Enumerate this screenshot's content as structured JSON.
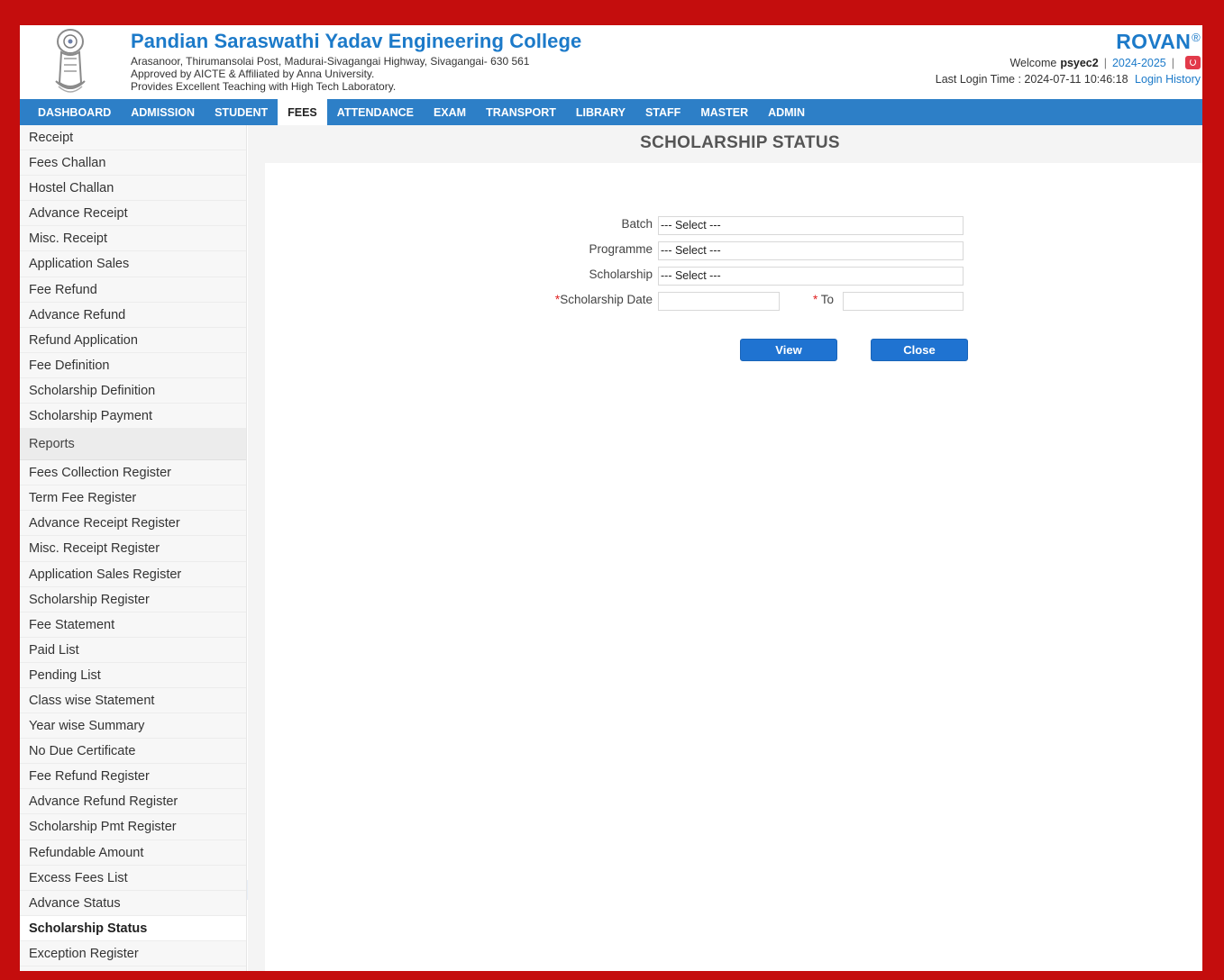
{
  "header": {
    "college_name": "Pandian Saraswathi Yadav Engineering College",
    "address_line1": "Arasanoor, Thirumansolai Post, Madurai-Sivagangai Highway, Sivagangai- 630 561",
    "address_line2": "Approved by AICTE & Affiliated by Anna University.",
    "address_line3": "Provides Excellent Teaching with High Tech Laboratory.",
    "brand": "ROVAN",
    "brand_mark": "®",
    "welcome_label": "Welcome",
    "username": "psyec2",
    "academic_year": "2024-2025",
    "separator": "|",
    "last_login_label": "Last Login Time : 2024-07-11 10:46:18",
    "login_history_link": "Login History",
    "logout_icon": "power-icon",
    "logo_icon": "college-emblem-icon"
  },
  "nav": [
    {
      "label": "DASHBOARD",
      "active": false
    },
    {
      "label": "ADMISSION",
      "active": false
    },
    {
      "label": "STUDENT",
      "active": false
    },
    {
      "label": "FEES",
      "active": true
    },
    {
      "label": "ATTENDANCE",
      "active": false
    },
    {
      "label": "EXAM",
      "active": false
    },
    {
      "label": "TRANSPORT",
      "active": false
    },
    {
      "label": "LIBRARY",
      "active": false
    },
    {
      "label": "STAFF",
      "active": false
    },
    {
      "label": "MASTER",
      "active": false
    },
    {
      "label": "ADMIN",
      "active": false
    }
  ],
  "sidebar": {
    "items": [
      "Receipt",
      "Fees Challan",
      "Hostel Challan",
      "Advance Receipt",
      "Misc. Receipt",
      "Application Sales",
      "Fee Refund",
      "Advance Refund",
      "Refund Application",
      "Fee Definition",
      "Scholarship Definition",
      "Scholarship Payment"
    ],
    "reports_section": "Reports",
    "report_items": [
      "Fees Collection Register",
      "Term Fee Register",
      "Advance Receipt Register",
      "Misc. Receipt Register",
      "Application Sales Register",
      "Scholarship Register",
      "Fee Statement",
      "Paid List",
      "Pending List",
      "Class wise Statement",
      "Year wise Summary",
      "No Due Certificate",
      "Fee Refund Register",
      "Advance Refund Register",
      "Scholarship Pmt Register",
      "Refundable Amount",
      "Excess Fees List",
      "Advance Status",
      "Scholarship Status",
      "Exception Register"
    ],
    "active_item": "Scholarship Status",
    "collapse_icon": "chevron-left-icon"
  },
  "main": {
    "page_title": "SCHOLARSHIP STATUS",
    "form": {
      "batch_label": "Batch",
      "batch_value": "--- Select ---",
      "programme_label": "Programme",
      "programme_value": "--- Select ---",
      "scholarship_label": "Scholarship",
      "scholarship_value": "--- Select ---",
      "required_mark": "*",
      "date_label": "Scholarship Date",
      "date_value": "",
      "to_label": "To",
      "to_value": ""
    },
    "view_button": "View",
    "close_button": "Close"
  },
  "colors": {
    "frame_border": "#c40d0d",
    "nav_bg": "#2d7fc7",
    "brand_blue": "#1c7ac9",
    "button_blue": "#1f73d1",
    "required_red": "#e02020"
  }
}
